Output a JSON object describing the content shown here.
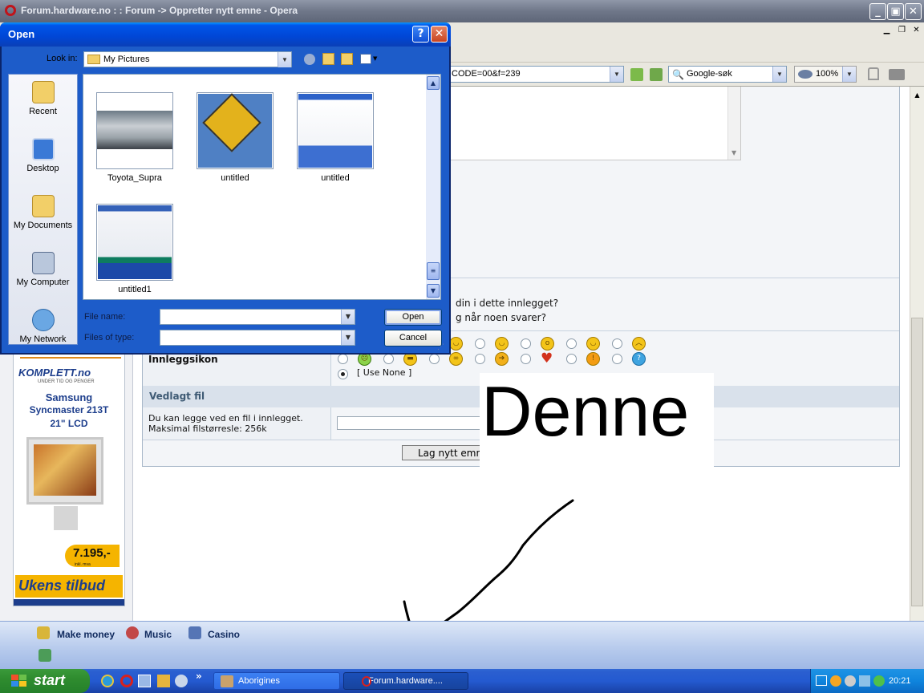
{
  "window": {
    "title": "Forum.hardware.no : : Forum -> Oppretter nytt emne - Opera",
    "minimize": "_",
    "restore": "▣",
    "close": "✕"
  },
  "toolbar": {
    "address_value": "CODE=00&f=239",
    "search_placeholder": "Google-søk",
    "zoom": "100%"
  },
  "dialog": {
    "title": "Open",
    "help": "?",
    "close": "✕",
    "look_in_label": "Look in:",
    "look_in_value": "My Pictures",
    "places": [
      {
        "label": "Recent",
        "icon": "recent-icon"
      },
      {
        "label": "Desktop",
        "icon": "desktop-icon"
      },
      {
        "label": "My Documents",
        "icon": "my-documents-icon"
      },
      {
        "label": "My Computer",
        "icon": "my-computer-icon"
      },
      {
        "label": "My Network",
        "icon": "my-network-icon"
      }
    ],
    "files": [
      {
        "name": "Toyota_Supra"
      },
      {
        "name": "untitled"
      },
      {
        "name": "untitled"
      },
      {
        "name": "untitled1"
      }
    ],
    "file_name_label": "File name:",
    "file_name_value": "",
    "files_of_type_label": "Files of type:",
    "files_of_type_value": "",
    "open_button": "Open",
    "cancel_button": "Cancel"
  },
  "form": {
    "question1": "din i dette innlegget?",
    "question2": "g når noen svarer?",
    "post_icon_label": "Innleggsikon",
    "use_none": "[ Use None ]",
    "attachment_header": "Vedlagt fil",
    "attachment_text1": "Du kan legge ved en fil i innlegget.",
    "attachment_text2": "Maksimal filstørresle: 256k",
    "submit_button": "Lag nytt emne"
  },
  "ad": {
    "brand": "KOMPLETT.no",
    "tagline": "UNDER TID OG PENGER",
    "product_line1": "Samsung",
    "product_line2": "Syncmaster 213T",
    "product_line3": "21\" LCD",
    "price": "7.195,-",
    "price_note": "inkl. mva",
    "footer": "Ukens tilbud"
  },
  "overlay": {
    "text": "Denne"
  },
  "quickbar": {
    "links": [
      "Make money",
      "Music",
      "Casino"
    ]
  },
  "taskbar": {
    "start": "start",
    "tasks": [
      "Aborigines",
      "Forum.hardware...."
    ],
    "clock": "20:21"
  }
}
